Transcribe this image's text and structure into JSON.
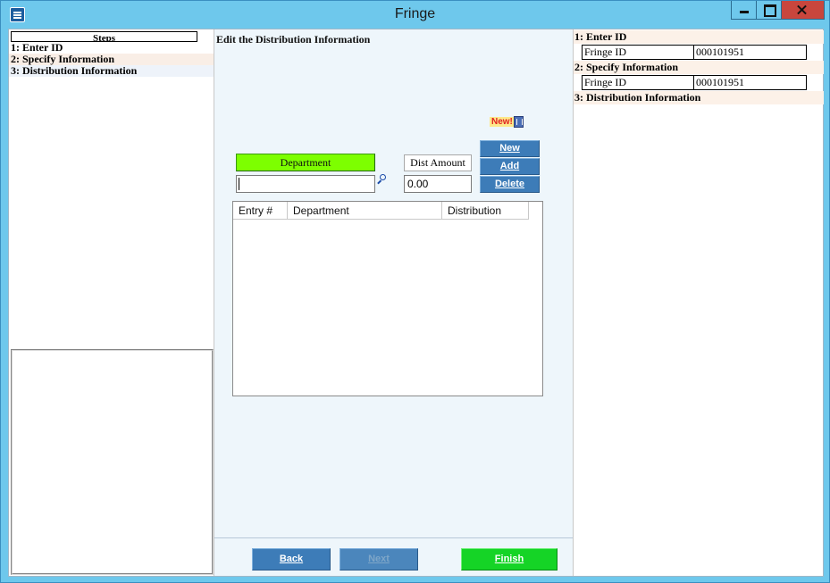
{
  "window": {
    "title": "Fringe"
  },
  "steps": {
    "header": "Steps",
    "items": [
      {
        "label": "1: Enter ID"
      },
      {
        "label": "2: Specify Information"
      },
      {
        "label": "3: Distribution Information"
      }
    ]
  },
  "center": {
    "title": "Edit the Distribution Information",
    "new_badge": "New!",
    "department_button": "Department",
    "department_value": "",
    "dist_amount_label": "Dist Amount",
    "dist_amount_value": "0.00",
    "buttons": {
      "new": "New",
      "add": "Add",
      "delete": "Delete"
    },
    "grid": {
      "columns": [
        "Entry #",
        "Department",
        "Distribution"
      ],
      "rows": []
    },
    "nav": {
      "back": "Back",
      "next": "Next",
      "finish": "Finish"
    }
  },
  "summary": {
    "sections": [
      {
        "heading": "1: Enter ID",
        "key": "Fringe ID",
        "value": "000101951"
      },
      {
        "heading": "2: Specify Information",
        "key": "Fringe ID",
        "value": "000101951"
      },
      {
        "heading": "3: Distribution Information"
      }
    ]
  },
  "colors": {
    "titlebar": "#6ec8ec",
    "department_button": "#7dff00",
    "action_button": "#3d7cb8",
    "finish_button": "#15d426",
    "close_button": "#c9463d"
  },
  "icons": [
    "app-icon",
    "minimize-icon",
    "maximize-icon",
    "close-icon",
    "lookup-icon",
    "new-book-icon"
  ]
}
